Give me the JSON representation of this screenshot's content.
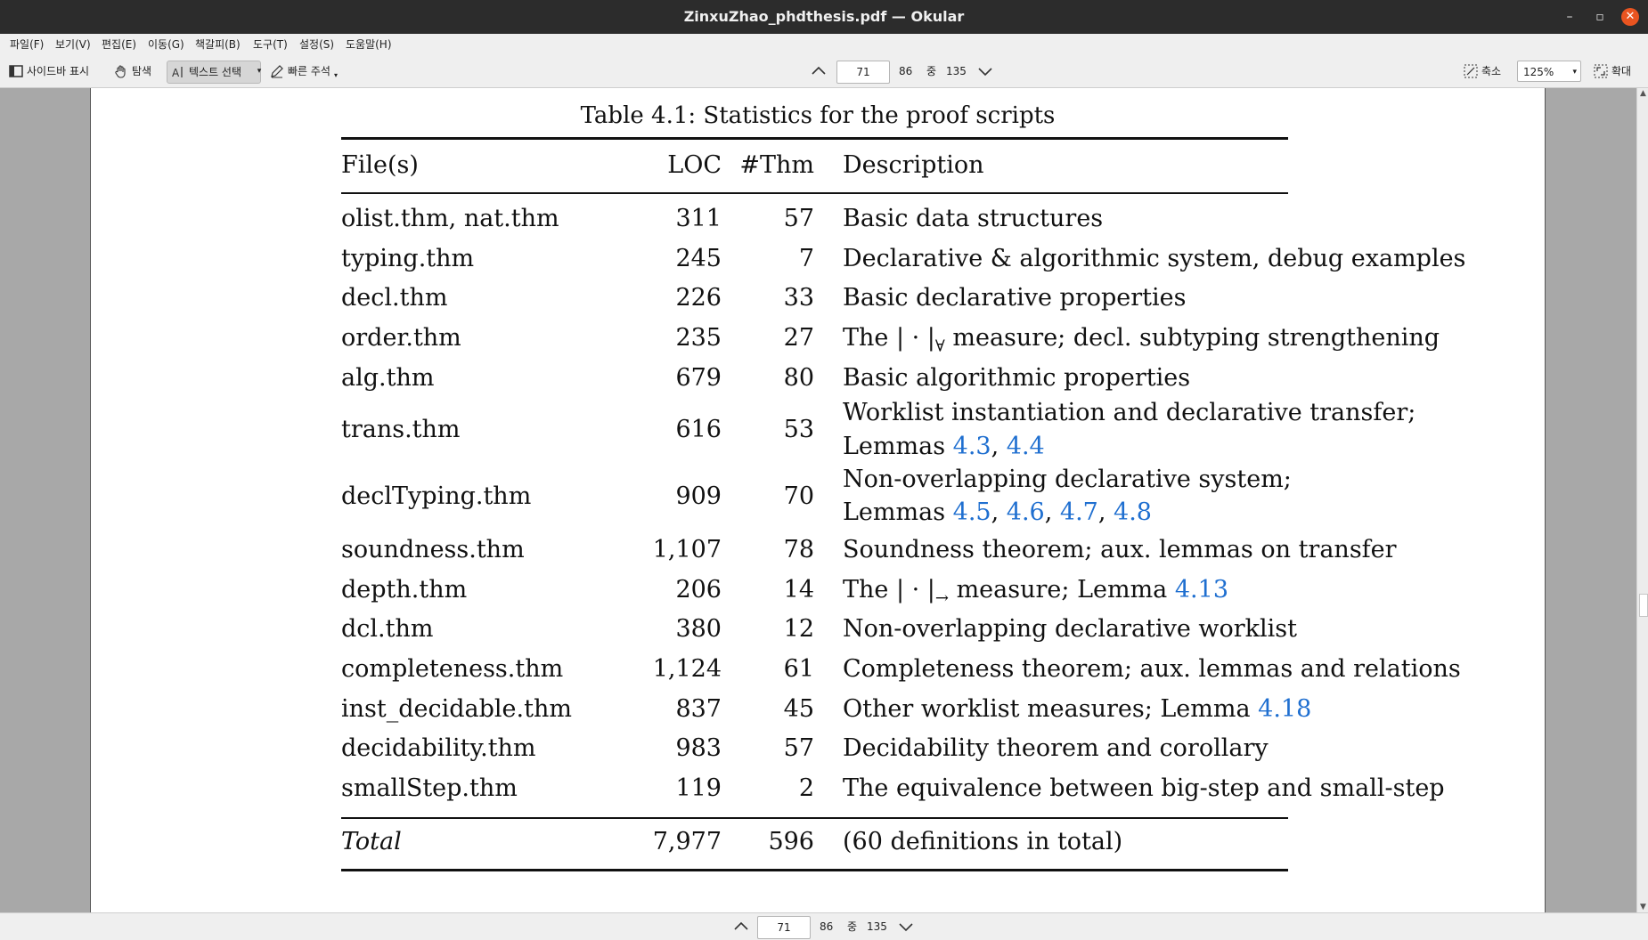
{
  "window": {
    "title": "ZinxuZhao_phdthesis.pdf — Okular"
  },
  "menu": [
    {
      "label": "파일(F)"
    },
    {
      "label": "보기(V)"
    },
    {
      "label": "편집(E)"
    },
    {
      "label": "이동(G)"
    },
    {
      "label": "책갈피(B)"
    },
    {
      "label": "도구(T)"
    },
    {
      "label": "설정(S)"
    },
    {
      "label": "도움말(H)"
    }
  ],
  "toolbar": {
    "sidebar_label": "사이드바 표시",
    "browse_label": "탐색",
    "text_select_label": "텍스트 선택",
    "quick_annotate_label": "빠른 주석",
    "current_page": "71",
    "page_label": "86",
    "of_label": "중",
    "total_pages": "135",
    "zoom_out_label": "축소",
    "zoom_value": "125%",
    "zoom_in_label": "확대"
  },
  "bottom_nav": {
    "current_page": "71",
    "page_label": "86",
    "of_label": "중",
    "total_pages": "135"
  },
  "document": {
    "caption": "Table 4.1: Statistics for the proof scripts",
    "headers": [
      "File(s)",
      "LOC",
      "#Thm",
      "Description"
    ],
    "rows": [
      {
        "file": "olist.thm, nat.thm",
        "loc": "311",
        "thm": "57",
        "desc": "Basic data structures"
      },
      {
        "file": "typing.thm",
        "loc": "245",
        "thm": "7",
        "desc": "Declarative & algorithmic system, debug examples"
      },
      {
        "file": "decl.thm",
        "loc": "226",
        "thm": "33",
        "desc": "Basic declarative properties"
      },
      {
        "file": "order.thm",
        "loc": "235",
        "thm": "27",
        "desc_a": "The | · |",
        "desc_sub": "∀",
        "desc_b": " measure; decl. subtyping strengthening"
      },
      {
        "file": "alg.thm",
        "loc": "679",
        "thm": "80",
        "desc": "Basic algorithmic properties"
      },
      {
        "file": "trans.thm",
        "loc": "616",
        "thm": "53",
        "desc_line1": "Worklist instantiation and declarative transfer;",
        "desc_line2_prefix": "Lemmas ",
        "links": [
          "4.3",
          "4.4"
        ],
        "sep": ", "
      },
      {
        "file": "declTyping.thm",
        "loc": "909",
        "thm": "70",
        "desc_line1": "Non-overlapping declarative system;",
        "desc_line2_prefix": "Lemmas ",
        "links": [
          "4.5",
          "4.6",
          "4.7",
          "4.8"
        ],
        "sep": ", "
      },
      {
        "file": "soundness.thm",
        "loc": "1,107",
        "thm": "78",
        "desc": "Soundness theorem; aux. lemmas on transfer"
      },
      {
        "file": "depth.thm",
        "loc": "206",
        "thm": "14",
        "desc_a": "The | · |",
        "desc_sub": "→",
        "desc_b": " measure; Lemma ",
        "link": "4.13"
      },
      {
        "file": "dcl.thm",
        "loc": "380",
        "thm": "12",
        "desc": "Non-overlapping declarative worklist"
      },
      {
        "file": "completeness.thm",
        "loc": "1,124",
        "thm": "61",
        "desc": "Completeness theorem; aux. lemmas and relations"
      },
      {
        "file": "inst_decidable.thm",
        "loc": "837",
        "thm": "45",
        "desc_a": "Other worklist measures; Lemma ",
        "link": "4.18"
      },
      {
        "file": "decidability.thm",
        "loc": "983",
        "thm": "57",
        "desc": "Decidability theorem and corollary"
      },
      {
        "file": "smallStep.thm",
        "loc": "119",
        "thm": "2",
        "desc": "The equivalence between big-step and small-step"
      }
    ],
    "total": {
      "label": "Total",
      "loc": "7,977",
      "thm": "596",
      "desc": "(60 definitions in total)"
    }
  },
  "colors": {
    "link": "#1f6fd0",
    "titlebar": "#2c2c2c",
    "close": "#e95420"
  }
}
